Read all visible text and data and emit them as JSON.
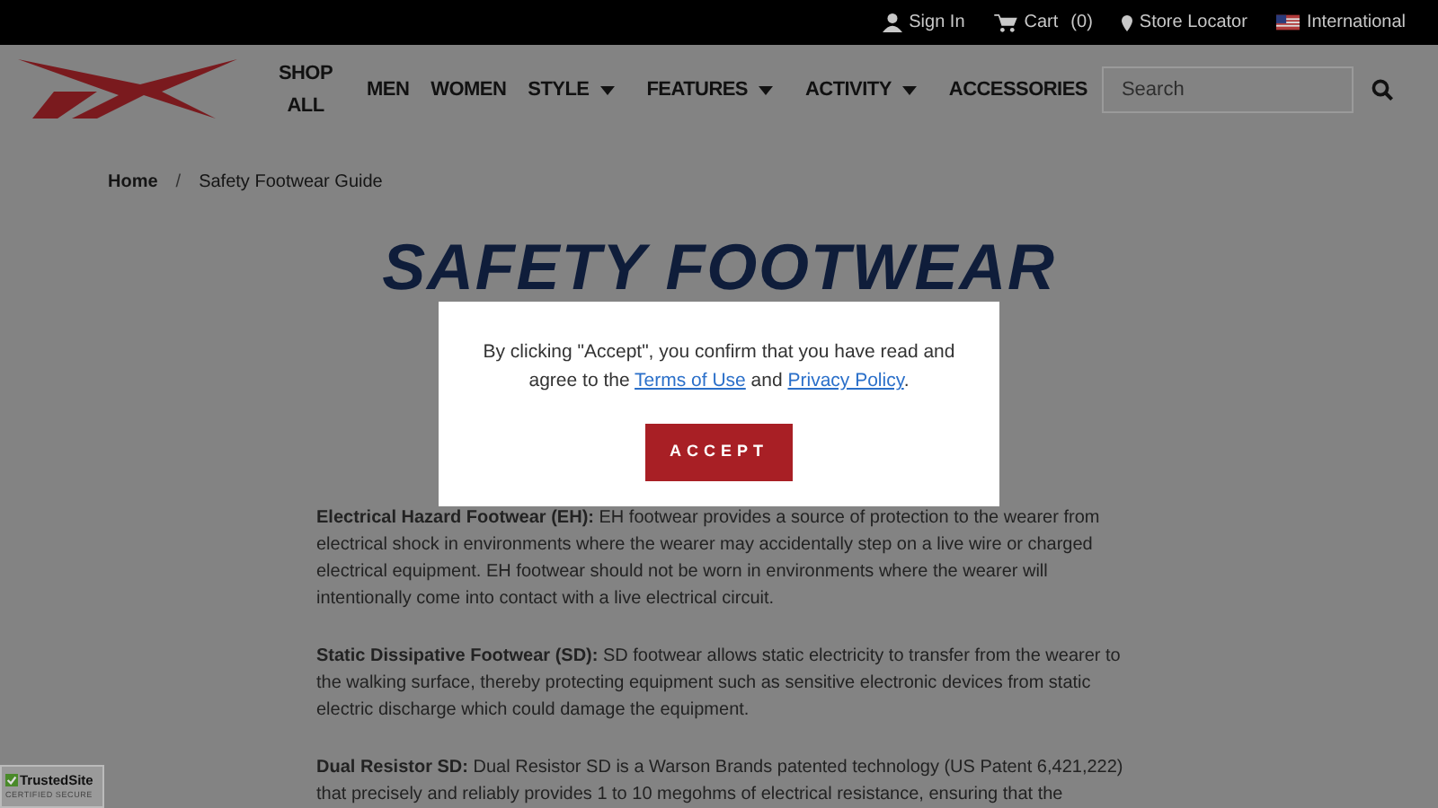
{
  "top_bar": {
    "links": [
      {
        "kind": "user",
        "label": "Sign In"
      },
      {
        "kind": "cart",
        "label": "Cart",
        "count": "(0)"
      },
      {
        "kind": "pin",
        "label": "Store Locator"
      },
      {
        "kind": "flag",
        "label": "International"
      }
    ]
  },
  "nav": {
    "items": [
      {
        "label": "SHOP ALL",
        "dropdown": false
      },
      {
        "label": "MEN",
        "dropdown": false
      },
      {
        "label": "WOMEN",
        "dropdown": false
      },
      {
        "label": "STYLE",
        "dropdown": true
      },
      {
        "label": "FEATURES",
        "dropdown": true
      },
      {
        "label": "ACTIVITY",
        "dropdown": true
      },
      {
        "label": "ACCESSORIES",
        "dropdown": false
      }
    ],
    "search": {
      "placeholder": "Search"
    }
  },
  "breadcrumb": {
    "separator": "/",
    "items": [
      "Home",
      "Safety Footwear Guide"
    ]
  },
  "title": "SAFETY FOOTWEAR",
  "sections": [
    {
      "term": "Electrical Hazard Footwear (EH):",
      "text": "EH footwear provides a source of protection to the wearer from electrical shock in environments where the wearer may accidentally step on a live wire or charged electrical equipment. EH footwear should not be worn in environments where the wearer will intentionally come into contact with a live electrical circuit."
    },
    {
      "term": "Static Dissipative Footwear (SD):",
      "text": "SD footwear allows static electricity to transfer from the wearer to the walking surface, thereby protecting equipment such as sensitive electronic devices from static electric discharge which could damage the equipment."
    },
    {
      "term": "Dual Resistor SD:",
      "text": "Dual Resistor SD is a Warson Brands patented technology (US Patent 6,421,222) that precisely and reliably provides 1 to 10 megohms of electrical resistance, ensuring that the"
    }
  ],
  "consent": {
    "text_before": "By clicking \"Accept\", you confirm that you have read and agree to the",
    "link_1": "Terms of Use",
    "text_between": "and",
    "link_2": "Privacy Policy",
    "text_after": ".",
    "button": "ACCEPT"
  },
  "trust_badge": {
    "name": "TrustedSite",
    "tagline": "CERTIFIED SECURE"
  }
}
